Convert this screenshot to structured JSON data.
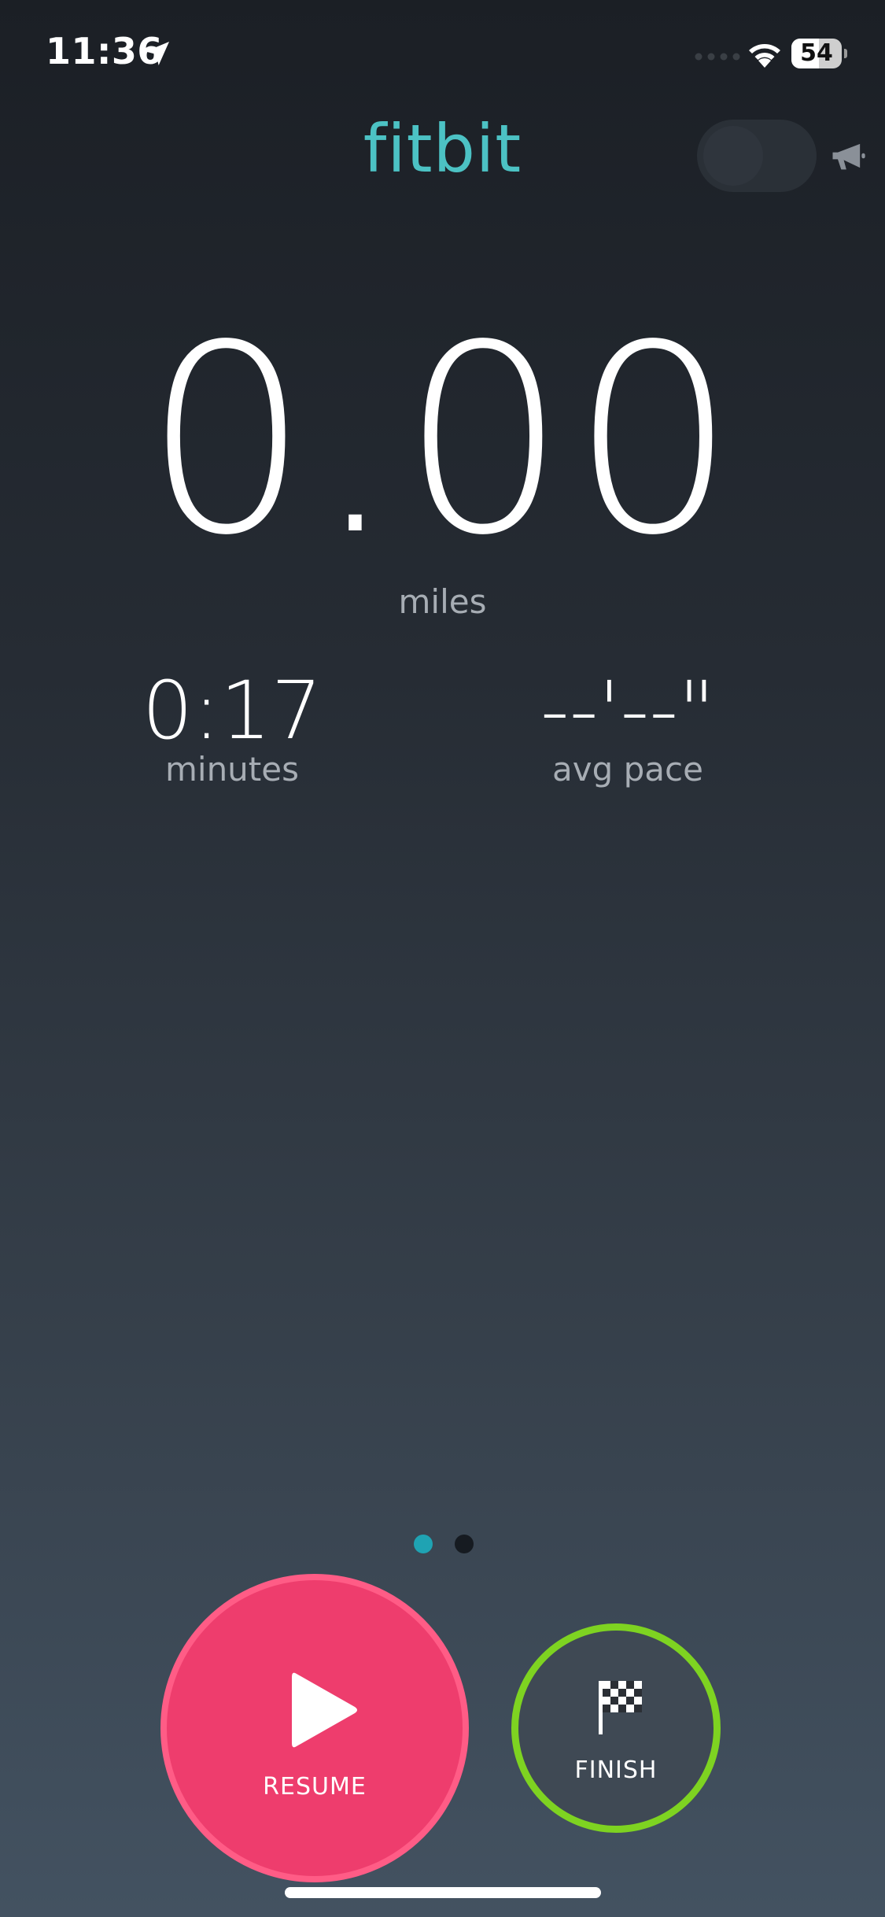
{
  "status_bar": {
    "time": "11:36",
    "battery_level": "54",
    "battery_fraction": 0.54,
    "icons": [
      "location-arrow-icon",
      "signal-icon",
      "wifi-icon",
      "battery-icon"
    ]
  },
  "header": {
    "logo": "fitbit",
    "voice_cues_toggle_on": false,
    "voice_icon": "megaphone-icon"
  },
  "stats": {
    "distance_value": "0.00",
    "distance_unit": "miles",
    "duration_value": "0:17",
    "duration_label": "minutes",
    "pace_value": "--'--\"",
    "pace_label": "avg pace"
  },
  "pager": {
    "active_index": 0,
    "count": 2
  },
  "controls": {
    "resume_label": "RESUME",
    "finish_label": "FINISH",
    "resume_icon": "play-icon",
    "finish_icon": "checkered-flag-icon"
  },
  "colors": {
    "brand": "#4cc2c4",
    "resume": "#ee3d6d",
    "finish_ring": "#7ed321",
    "page_dot_active": "#1fa3b3"
  }
}
